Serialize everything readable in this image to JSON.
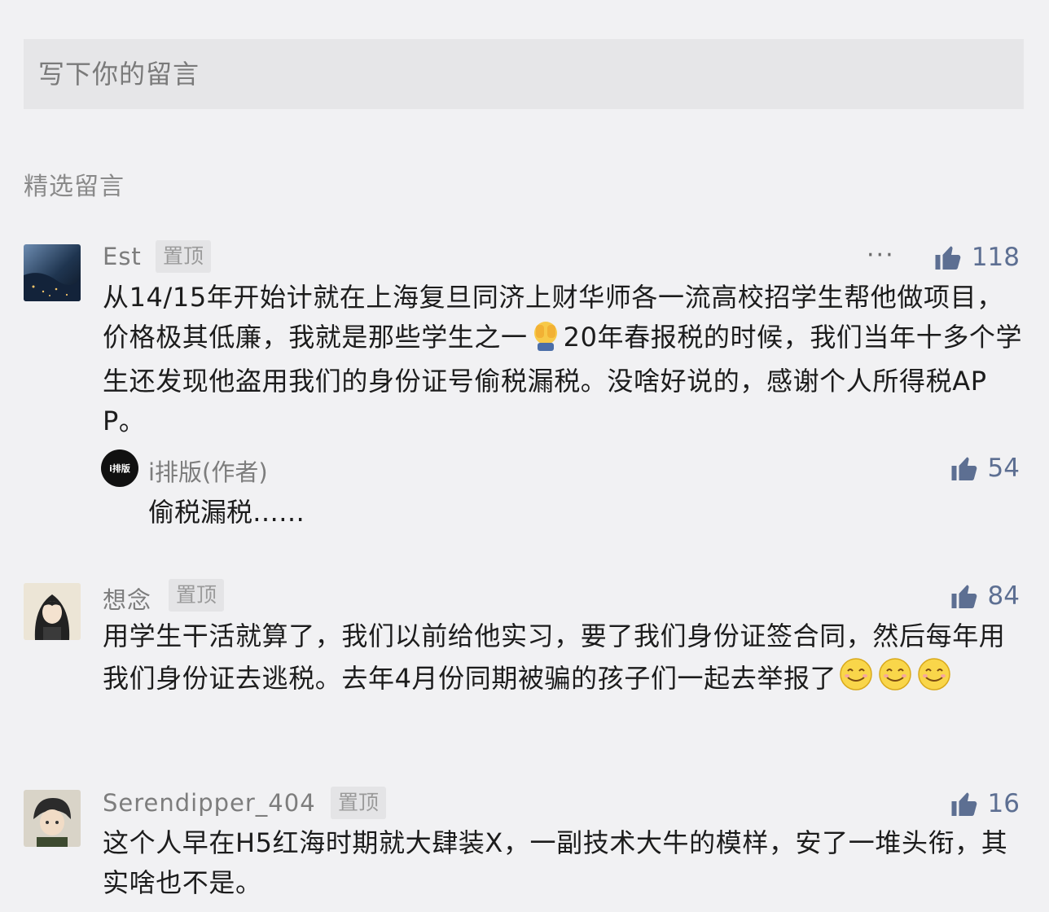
{
  "input": {
    "placeholder": "写下你的留言"
  },
  "section_title": "精选留言",
  "comments": [
    {
      "nickname": "Est",
      "pin_label": "置顶",
      "more": "···",
      "likes": "118",
      "text_before": "从14/15年开始计就在上海复旦同济上财华师各一流高校招学生帮他做项目，价格极其低廉，我就是那些学生之一",
      "text_after": "20年春报税的时候，我们当年十多个学生还发现他盗用我们的身份证号偷税漏税。没啥好说的，感谢个人所得税APP。",
      "reply": {
        "avatar_text": "i排版",
        "nickname": "i排版(作者)",
        "likes": "54",
        "text": "偷税漏税……"
      }
    },
    {
      "nickname": "想念",
      "pin_label": "置顶",
      "likes": "84",
      "text": "用学生干活就算了，我们以前给他实习，要了我们身份证签合同，然后每年用我们身份证去逃税。去年4月份同期被骗的孩子们一起去举报了"
    },
    {
      "nickname": "Serendipper_404",
      "pin_label": "置顶",
      "likes": "16",
      "text": "这个人早在H5红海时期就大肆装X，一副技术大牛的模样，安了一堆头衔，其实啥也不是。"
    }
  ],
  "colors": {
    "like": "#5d6f92",
    "background": "#f1f1f3"
  },
  "icons": [
    "thumbs-up-icon",
    "more-icon",
    "facepalm-emoji",
    "smile-emoji"
  ]
}
